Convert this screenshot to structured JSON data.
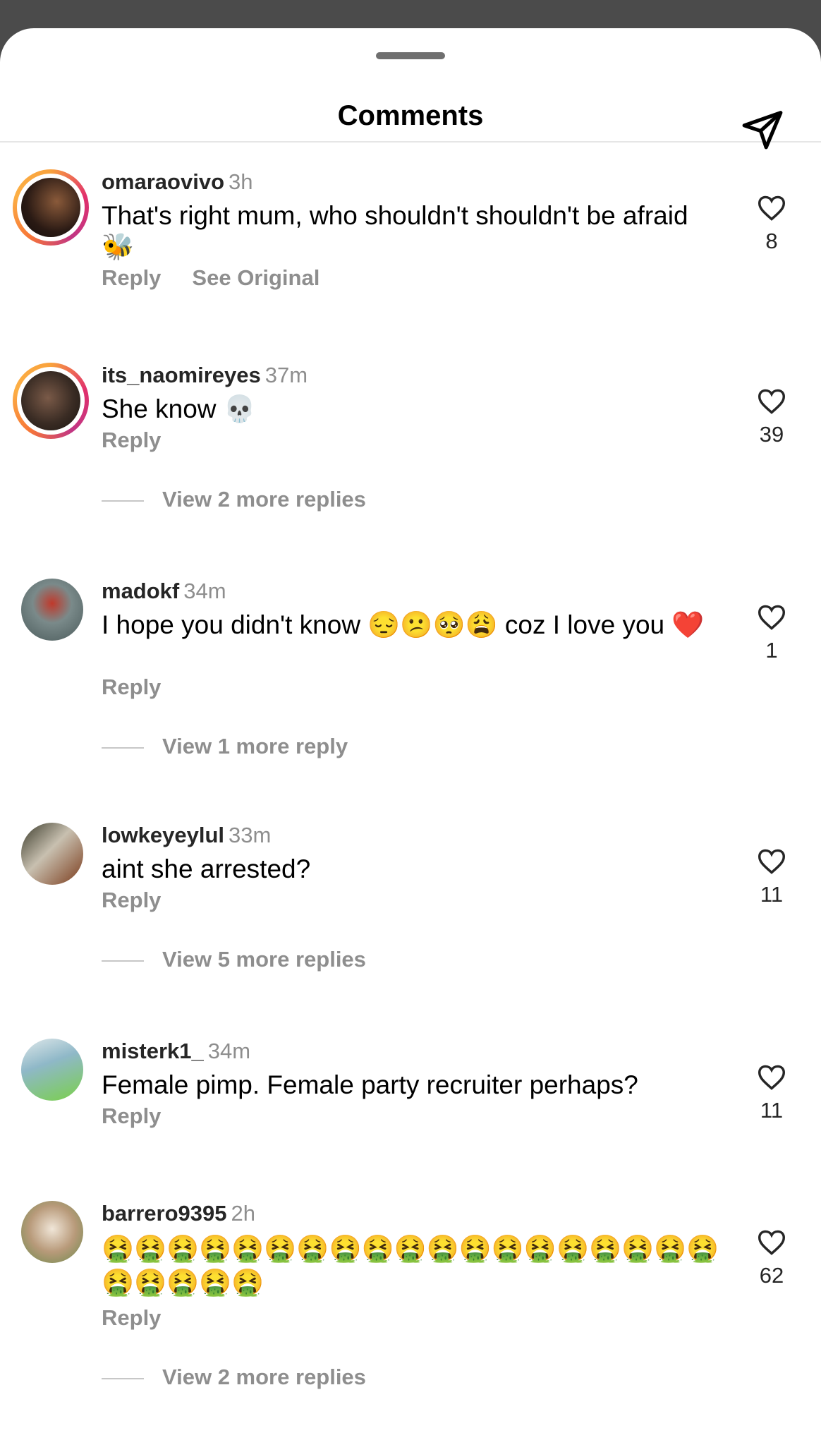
{
  "header": {
    "title": "Comments",
    "share_icon": "send-icon"
  },
  "comments": [
    {
      "username": "omaraovivo",
      "time": "3h",
      "text": "That's right mum, who shouldn't shouldn't be afraid 🐝",
      "likes": "8",
      "reply": "Reply",
      "see_original": "See Original",
      "has_story_ring": true,
      "avatar_color": "#2a1a14"
    },
    {
      "username": "its_naomireyes",
      "time": "37m",
      "text": "She know 💀",
      "likes": "39",
      "reply": "Reply",
      "view_more": "View 2 more replies",
      "has_story_ring": true,
      "avatar_color": "#3a2c24"
    },
    {
      "username": "madokf",
      "time": "34m",
      "text": "I hope you didn't know 😔😕🥺😩 coz I love you ❤️",
      "likes": "1",
      "reply": "Reply",
      "view_more": "View 1 more reply",
      "has_story_ring": false,
      "avatar_color": "#6b7a7a"
    },
    {
      "username": "lowkeyeylul",
      "time": "33m",
      "text": "aint she arrested?",
      "likes": "11",
      "reply": "Reply",
      "view_more": "View 5 more replies",
      "has_story_ring": false,
      "avatar_color": "#7a6a3a"
    },
    {
      "username": "misterk1_",
      "time": "34m",
      "text": "Female pimp. Female party recruiter perhaps?",
      "likes": "11",
      "reply": "Reply",
      "has_story_ring": false,
      "avatar_color": "#8fb8c8"
    },
    {
      "username": "barrero9395",
      "time": "2h",
      "text": "🤮🤮🤮🤮🤮🤮🤮🤮🤮🤮🤮🤮🤮🤮🤮🤮🤮🤮🤮🤮🤮🤮🤮🤮",
      "likes": "62",
      "reply": "Reply",
      "view_more": "View 2 more replies",
      "has_story_ring": false,
      "avatar_color": "#b89a7a"
    }
  ]
}
